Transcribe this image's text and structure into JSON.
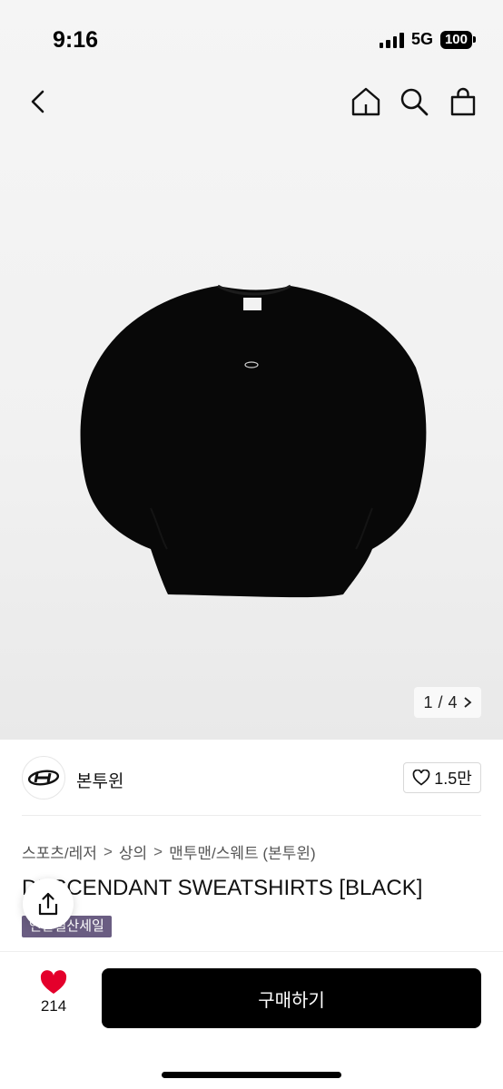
{
  "status": {
    "time": "9:16",
    "network": "5G",
    "battery": "100"
  },
  "nav": {
    "back_icon": "chevron-left-icon",
    "home_icon": "home-icon",
    "search_icon": "search-icon",
    "bag_icon": "shopping-bag-icon"
  },
  "gallery": {
    "current": "1",
    "total": "4",
    "separator": " / "
  },
  "brand": {
    "name": "본투윈",
    "likes": "1.5만"
  },
  "breadcrumb": [
    "스포츠/레저",
    "상의",
    "맨투맨/스웨트 (본투윈)"
  ],
  "product": {
    "title": "DESCENDANT SWEATSHIRTS [BLACK]",
    "badge": "연말결산세일"
  },
  "bottom": {
    "wish_count": "214",
    "buy_label": "구매하기"
  },
  "colors": {
    "buy_button": "#000000",
    "badge": "#6a5d82",
    "heart": "#e4002b"
  }
}
